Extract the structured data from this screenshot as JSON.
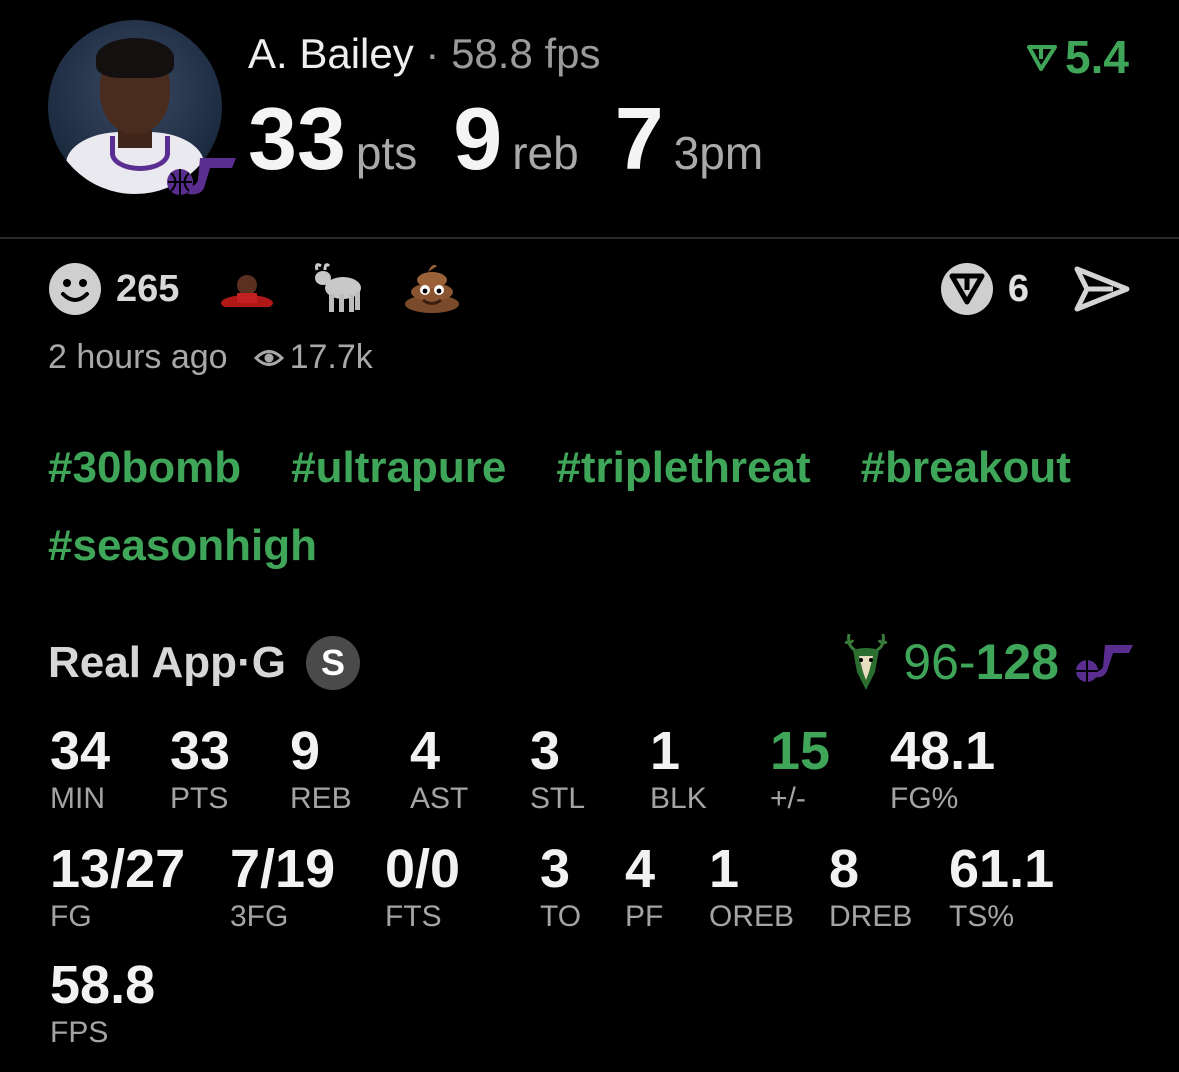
{
  "header": {
    "player_name": "A. Bailey",
    "separator": " · ",
    "fps": "58.8 fps",
    "score_change": "5.4",
    "stats": [
      {
        "value": "33",
        "unit": "pts"
      },
      {
        "value": "9",
        "unit": "reb"
      },
      {
        "value": "7",
        "unit": "3pm"
      }
    ]
  },
  "reactions": {
    "reaction_count": "265",
    "emojis": [
      "player-emoji",
      "goat-emoji",
      "poop-emoji"
    ],
    "prediction_count": "6"
  },
  "meta": {
    "time_ago": "2 hours ago",
    "views": "17.7k"
  },
  "tags": [
    "#30bomb",
    "#ultrapure",
    "#triplethreat",
    "#breakout",
    "#seasonhigh"
  ],
  "game": {
    "app_name": "Real App",
    "separator": " · ",
    "position": "G",
    "badge": "S",
    "score_left": "96-",
    "score_right": "128"
  },
  "box_score": [
    {
      "label": "MIN",
      "value": "34"
    },
    {
      "label": "PTS",
      "value": "33"
    },
    {
      "label": "REB",
      "value": "9"
    },
    {
      "label": "AST",
      "value": "4"
    },
    {
      "label": "STL",
      "value": "3"
    },
    {
      "label": "BLK",
      "value": "1"
    },
    {
      "label": "+/-",
      "value": "15"
    },
    {
      "label": "FG%",
      "value": "48.1"
    },
    {
      "label": "FG",
      "value": "13/27"
    },
    {
      "label": "3FG",
      "value": "7/19"
    },
    {
      "label": "FTS",
      "value": "0/0"
    },
    {
      "label": "TO",
      "value": "3"
    },
    {
      "label": "PF",
      "value": "4"
    },
    {
      "label": "OREB",
      "value": "1"
    },
    {
      "label": "DREB",
      "value": "8"
    },
    {
      "label": "TS%",
      "value": "61.1"
    },
    {
      "label": "FPS",
      "value": "58.8"
    }
  ],
  "colors": {
    "accent_green": "#3fa659",
    "team_purple": "#5a2d91",
    "background": "#000000"
  }
}
